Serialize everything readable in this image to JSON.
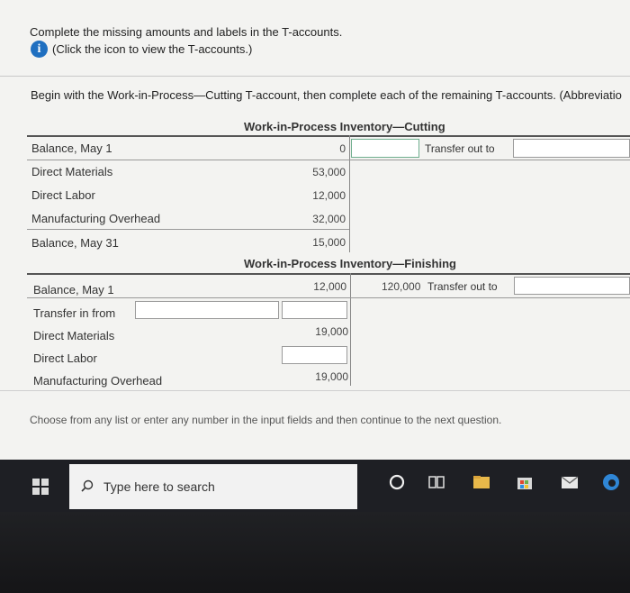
{
  "instructions": {
    "line1": "Complete the missing amounts and labels in the T-accounts.",
    "line2": "(Click the icon to view the T-accounts.)",
    "begin": "Begin with the Work-in-Process—Cutting T-account, then complete each of the remaining T-accounts. (Abbreviatio"
  },
  "cutting": {
    "title": "Work-in-Process Inventory—Cutting",
    "rows": [
      {
        "label": "Balance, May 1",
        "value": "0"
      },
      {
        "label": "Direct Materials",
        "value": "53,000"
      },
      {
        "label": "Direct Labor",
        "value": "12,000"
      },
      {
        "label": "Manufacturing Overhead",
        "value": "32,000"
      },
      {
        "label": "Balance, May 31",
        "value": "15,000"
      }
    ],
    "credit_label": "Transfer out to"
  },
  "finishing": {
    "title": "Work-in-Process Inventory—Finishing",
    "rows": [
      {
        "label": "Balance, May 1",
        "value": "12,000"
      },
      {
        "label": "Transfer in from",
        "value": ""
      },
      {
        "label": "Direct Materials",
        "value": "19,000"
      },
      {
        "label": "Direct Labor",
        "value": ""
      },
      {
        "label": "Manufacturing Overhead",
        "value": "19,000"
      }
    ],
    "credit_amount": "120,000",
    "credit_label": "Transfer out to"
  },
  "footer": "Choose from any list or enter any number in the input fields and then continue to the next question.",
  "taskbar": {
    "search_placeholder": "Type here to search",
    "icons": [
      "windows-icon",
      "search-icon",
      "cortana-icon",
      "task-view-icon",
      "file-explorer-icon",
      "store-icon",
      "mail-icon",
      "edge-icon"
    ]
  },
  "colors": {
    "info_icon": "#1f6fc0",
    "box_border_green": "#6fae8e"
  }
}
